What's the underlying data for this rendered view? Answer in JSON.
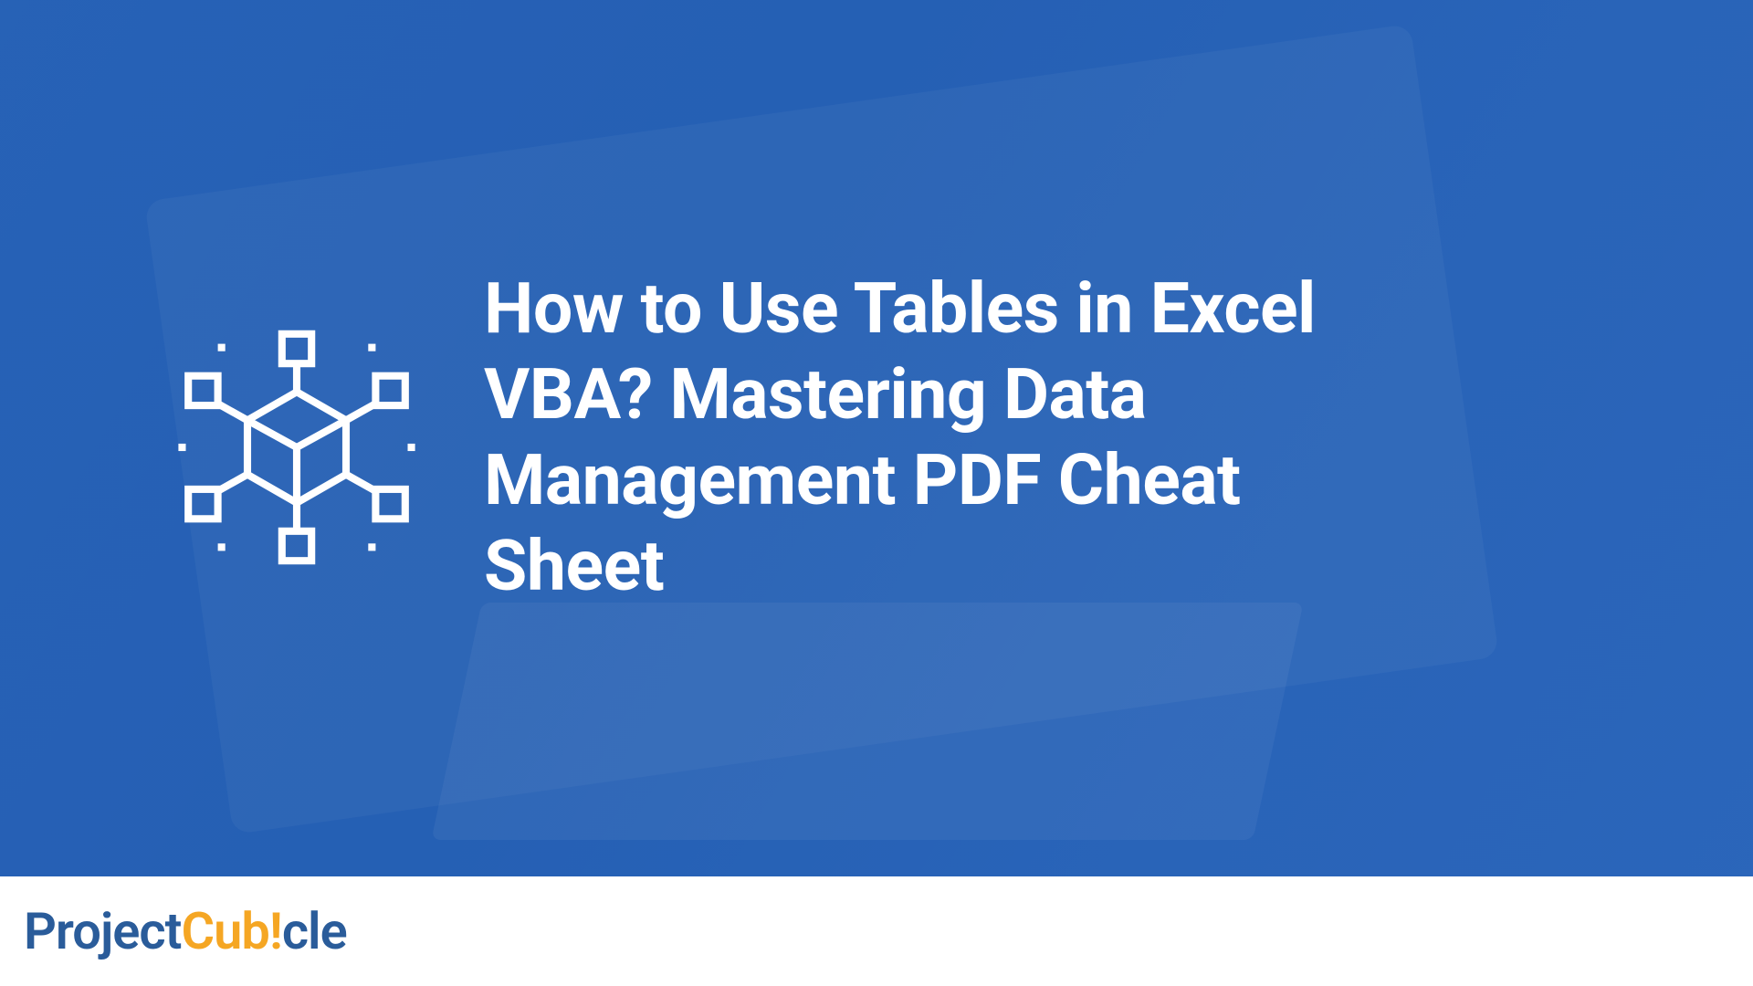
{
  "hero": {
    "headline": "How to Use Tables in Excel VBA? Mastering Data Management PDF Cheat Sheet",
    "icon_name": "blockchain-cube-icon"
  },
  "footer": {
    "logo_part1": "Project",
    "logo_part2": "Cub",
    "logo_exclaim": "!",
    "logo_part4": "cle"
  },
  "colors": {
    "hero_overlay": "#225eb4",
    "logo_blue": "#2a5c9a",
    "logo_orange": "#f5a623"
  }
}
